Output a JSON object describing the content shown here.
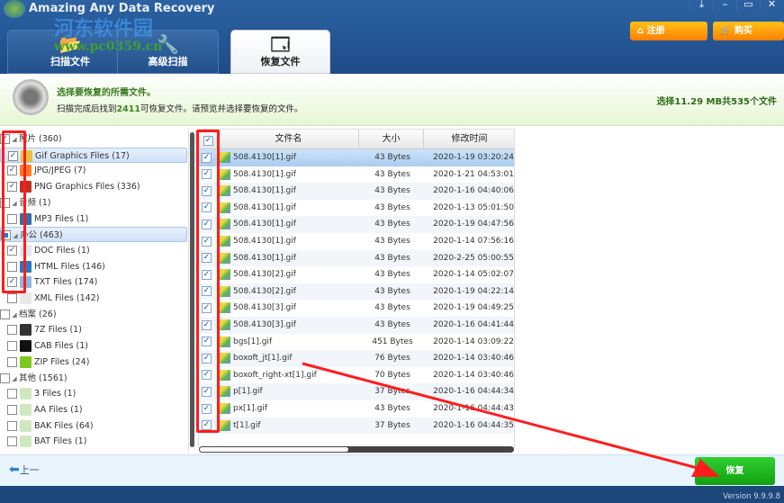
{
  "app": {
    "title": "Amazing Any Data Recovery",
    "watermark": "河东软件园",
    "watermark_url": "www.pc0359.cn"
  },
  "tabs": [
    {
      "label": "扫描文件",
      "icon": "scan-icon"
    },
    {
      "label": "高级扫描",
      "icon": "tools-icon"
    },
    {
      "label": "恢复文件",
      "icon": "recover-icon",
      "active": true
    }
  ],
  "window_controls": [
    "⤓",
    "–",
    "▭",
    "✕"
  ],
  "buttons": {
    "register": "注册",
    "buy": "购买",
    "back": "上一",
    "recover": "恢复"
  },
  "info": {
    "heading": "选择要恢复的所需文件。",
    "desc_prefix": "扫描完成后找到",
    "found_count": "2411",
    "desc_suffix": "可恢复文件。请预览并选择要恢复的文件。",
    "selection": "选择11.29 MB共535个文件"
  },
  "tree": [
    {
      "label": "照片 (360)",
      "level": 0,
      "state": "on"
    },
    {
      "label": "Gif Graphics Files (17)",
      "level": 1,
      "state": "on",
      "selected": true,
      "color": "#e8c040"
    },
    {
      "label": "JPG/JPEG (7)",
      "level": 1,
      "state": "on",
      "color": "#ff7a20"
    },
    {
      "label": "PNG Graphics Files (336)",
      "level": 1,
      "state": "on",
      "color": "#c03020"
    },
    {
      "label": "音频 (1)",
      "level": 0,
      "state": "off"
    },
    {
      "label": "MP3 Files (1)",
      "level": 1,
      "state": "off",
      "color": "#3a6aa8"
    },
    {
      "label": "办公 (463)",
      "level": 0,
      "state": "part",
      "selected": true
    },
    {
      "label": "DOC Files (1)",
      "level": 1,
      "state": "on",
      "color": "#dfe8f2"
    },
    {
      "label": "HTML Files (146)",
      "level": 1,
      "state": "off",
      "color": "#2a78c0"
    },
    {
      "label": "TXT Files (174)",
      "level": 1,
      "state": "on",
      "color": "#8ab8e0"
    },
    {
      "label": "XML Files (142)",
      "level": 1,
      "state": "off",
      "color": "#e8e8e8"
    },
    {
      "label": "档案 (26)",
      "level": 0,
      "state": "off"
    },
    {
      "label": "7Z Files (1)",
      "level": 1,
      "state": "off",
      "color": "#333"
    },
    {
      "label": "CAB Files (1)",
      "level": 1,
      "state": "off",
      "color": "#111"
    },
    {
      "label": "ZIP Files (24)",
      "level": 1,
      "state": "off",
      "color": "#7cc820"
    },
    {
      "label": "其他 (1561)",
      "level": 0,
      "state": "off"
    },
    {
      "label": "3 Files (1)",
      "level": 1,
      "state": "off",
      "color": "#cfe8c0"
    },
    {
      "label": "AA Files (1)",
      "level": 1,
      "state": "off",
      "color": "#cfe8c0"
    },
    {
      "label": "BAK Files (64)",
      "level": 1,
      "state": "off",
      "color": "#cfe8c0"
    },
    {
      "label": "BAT Files (1)",
      "level": 1,
      "state": "off",
      "color": "#cfe8c0"
    }
  ],
  "table": {
    "headers": [
      "文件名",
      "大小",
      "修改时间"
    ],
    "rows": [
      [
        "508.4130[1].gif",
        "43 Bytes",
        "2020-1-19 03:20:24"
      ],
      [
        "508.4130[1].gif",
        "43 Bytes",
        "2020-1-21 04:53:01"
      ],
      [
        "508.4130[1].gif",
        "43 Bytes",
        "2020-1-16 04:40:06"
      ],
      [
        "508.4130[1].gif",
        "43 Bytes",
        "2020-1-13 05:01:50"
      ],
      [
        "508.4130[1].gif",
        "43 Bytes",
        "2020-1-19 04:47:56"
      ],
      [
        "508.4130[1].gif",
        "43 Bytes",
        "2020-1-14 07:56:16"
      ],
      [
        "508.4130[1].gif",
        "43 Bytes",
        "2020-2-25 05:00:55"
      ],
      [
        "508.4130[2].gif",
        "43 Bytes",
        "2020-1-14 05:02:07"
      ],
      [
        "508.4130[2].gif",
        "43 Bytes",
        "2020-1-19 04:22:14"
      ],
      [
        "508.4130[3].gif",
        "43 Bytes",
        "2020-1-19 04:49:25"
      ],
      [
        "508.4130[3].gif",
        "43 Bytes",
        "2020-1-16 04:41:44"
      ],
      [
        "bgs[1].gif",
        "451 Bytes",
        "2020-1-14 03:09:22"
      ],
      [
        "boxoft_jt[1].gif",
        "76 Bytes",
        "2020-1-14 03:40:46"
      ],
      [
        "boxoft_right-xt[1].gif",
        "70 Bytes",
        "2020-1-14 03:40:46"
      ],
      [
        "p[1].gif",
        "37 Bytes",
        "2020-1-16 04:44:34"
      ],
      [
        "px[1].gif",
        "43 Bytes",
        "2020-1-16 04:44:43"
      ],
      [
        "t[1].gif",
        "37 Bytes",
        "2020-1-16 04:44:35"
      ]
    ]
  },
  "status": {
    "version": "Version 9.9.9.8"
  }
}
